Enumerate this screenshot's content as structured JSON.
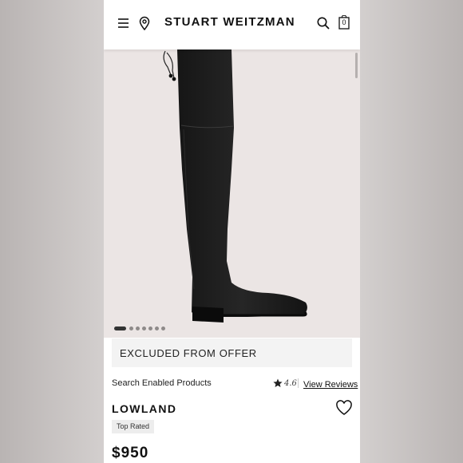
{
  "header": {
    "menu_icon": "hamburger-menu-icon",
    "location_icon": "location-pin-icon",
    "brand": "STUART WEITZMAN",
    "search_icon": "search-icon",
    "cart_icon": "shopping-bag-icon",
    "cart_count": "0"
  },
  "gallery": {
    "image": "black over-the-knee suede boot",
    "slide_count": 7,
    "active_slide": 1
  },
  "offer_banner": "EXCLUDED FROM OFFER",
  "product": {
    "collection": "Search Enabled Products",
    "rating": "4.6",
    "reviews_link": "View Reviews",
    "name": "LOWLAND",
    "badge": "Top Rated",
    "price": "$950"
  },
  "colors": {
    "background": "#c9c4c3",
    "hero_background": "#ebe5e4",
    "text": "#111111"
  }
}
